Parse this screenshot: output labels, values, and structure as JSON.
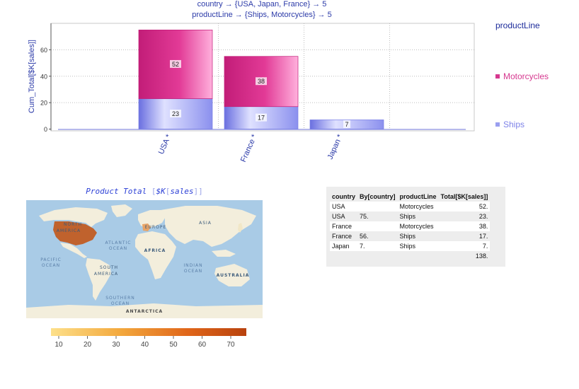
{
  "header": {
    "line1": "country → {USA, Japan, France} → 5",
    "line2": "productLine → {Ships, Motorcycles} → 5"
  },
  "chart_data": {
    "type": "bar",
    "stacked": true,
    "categories": [
      "USA",
      "France",
      "Japan"
    ],
    "category_labels": [
      "USA *",
      "France *",
      "Japan *"
    ],
    "series": [
      {
        "name": "Ships",
        "values": [
          23,
          17,
          7
        ],
        "color": "#9a9ff0"
      },
      {
        "name": "Motorcycles",
        "values": [
          52,
          38,
          0
        ],
        "color": "#d6388f"
      }
    ],
    "data_labels": [
      [
        "23",
        "17",
        "7"
      ],
      [
        "52",
        "38",
        ""
      ]
    ],
    "ylabel": "Cum_Total[$K[sales]]",
    "xlabel": "",
    "ylim": [
      0,
      80
    ],
    "yticks": [
      0,
      20,
      40,
      60
    ],
    "grid": true,
    "legend_title": "productLine",
    "legend_placement": "right"
  },
  "map": {
    "title_prefix": "Product Total",
    "title_inner": "$K",
    "title_inner2": "sales",
    "labels": [
      "NORTH",
      "AMERICA",
      "EUROPE",
      "ASIA",
      "ATLANTIC",
      "OCEAN",
      "AFRICA",
      "PACIFIC",
      "OCEAN",
      "SOUTH",
      "AMERICA",
      "INDIAN",
      "OCEAN",
      "AUSTRALIA",
      "SOUTHERN",
      "OCEAN",
      "ANTARCTICA"
    ],
    "scale_ticks": [
      "10",
      "20",
      "30",
      "40",
      "50",
      "60",
      "70"
    ],
    "colors": {
      "ocean": "#a9cbe6",
      "land": "#f3eedc",
      "usa": "#c0622d",
      "france": "#e8a467"
    }
  },
  "table": {
    "headers": [
      "country",
      "By[country]",
      "productLine",
      "Total[$K[sales]]"
    ],
    "rows": [
      [
        "USA",
        "",
        "Motorcycles",
        "52."
      ],
      [
        "USA",
        "75.",
        "Ships",
        "23."
      ],
      [
        "France",
        "",
        "Motorcycles",
        "38."
      ],
      [
        "France",
        "56.",
        "Ships",
        "17."
      ],
      [
        "Japan",
        "7.",
        "Ships",
        "7."
      ],
      [
        "",
        "",
        "",
        "138."
      ]
    ]
  }
}
